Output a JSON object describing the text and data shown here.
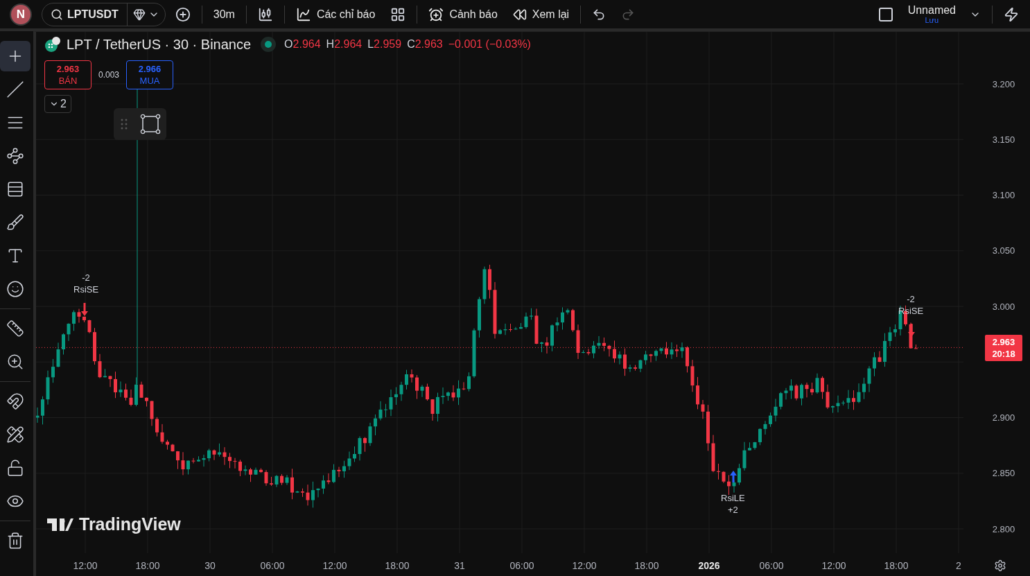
{
  "top_bar": {
    "avatar": "N",
    "symbol": "LPTUSDT",
    "interval": "30m",
    "indicators": "Các chỉ báo",
    "alerts": "Cảnh báo",
    "replay": "Xem lại",
    "layout_name": "Unnamed",
    "layout_status": "Lưu"
  },
  "left_toolbar": [
    {
      "kind": "crosshair",
      "selected": true
    },
    {
      "kind": "trend-line",
      "selected": false
    },
    {
      "kind": "lines",
      "selected": false
    },
    {
      "kind": "pattern",
      "selected": false
    },
    {
      "kind": "fib",
      "selected": false
    },
    {
      "kind": "brush",
      "selected": false
    },
    {
      "kind": "text",
      "selected": false
    },
    {
      "kind": "emoji",
      "selected": false
    },
    {
      "kind": "ruler",
      "selected": false
    },
    {
      "kind": "zoom",
      "selected": false
    },
    {
      "kind": "magnet",
      "selected": false
    },
    {
      "kind": "pencil",
      "selected": false
    },
    {
      "kind": "lock",
      "selected": false
    },
    {
      "kind": "eye",
      "selected": false
    },
    {
      "kind": "trash",
      "selected": false
    }
  ],
  "legend": {
    "title": "LPT / TetherUS · 30 · Binance",
    "ohlc": [
      {
        "label": "O",
        "value": "2.964"
      },
      {
        "label": "H",
        "value": "2.964"
      },
      {
        "label": "L",
        "value": "2.959"
      },
      {
        "label": "C",
        "value": "2.963"
      }
    ],
    "change": "−0.001 (−0.03%)"
  },
  "trade": {
    "sell_price": "2.963",
    "sell_label": "BÁN",
    "spread": "0.003",
    "buy_price": "2.966",
    "buy_label": "MUA"
  },
  "collapse_count": "2",
  "signals": [
    {
      "kind": "short",
      "count": "-2",
      "label": "RsiSE"
    },
    {
      "kind": "long",
      "count": "+2",
      "label": "RsiLE"
    },
    {
      "kind": "short",
      "count": "-2",
      "label": "RsiSE"
    }
  ],
  "logo_text": "TradingView",
  "price_axis": {
    "above": [
      "3.200",
      "3.150",
      "3.100",
      "3.050",
      "3.000"
    ],
    "below": [
      "2.900",
      "2.850",
      "2.800"
    ]
  },
  "current_price": {
    "price": "2.963",
    "countdown": "20:18"
  },
  "time_axis": [
    {
      "label": "12:00",
      "bold": false
    },
    {
      "label": "18:00",
      "bold": false
    },
    {
      "label": "30",
      "bold": false
    },
    {
      "label": "06:00",
      "bold": false
    },
    {
      "label": "12:00",
      "bold": false
    },
    {
      "label": "18:00",
      "bold": false
    },
    {
      "label": "31",
      "bold": false
    },
    {
      "label": "06:00",
      "bold": false
    },
    {
      "label": "12:00",
      "bold": false
    },
    {
      "label": "18:00",
      "bold": false
    },
    {
      "label": "2026",
      "bold": true
    },
    {
      "label": "06:00",
      "bold": false
    },
    {
      "label": "12:00",
      "bold": false
    },
    {
      "label": "18:00",
      "bold": false
    },
    {
      "label": "2",
      "bold": false
    }
  ]
}
